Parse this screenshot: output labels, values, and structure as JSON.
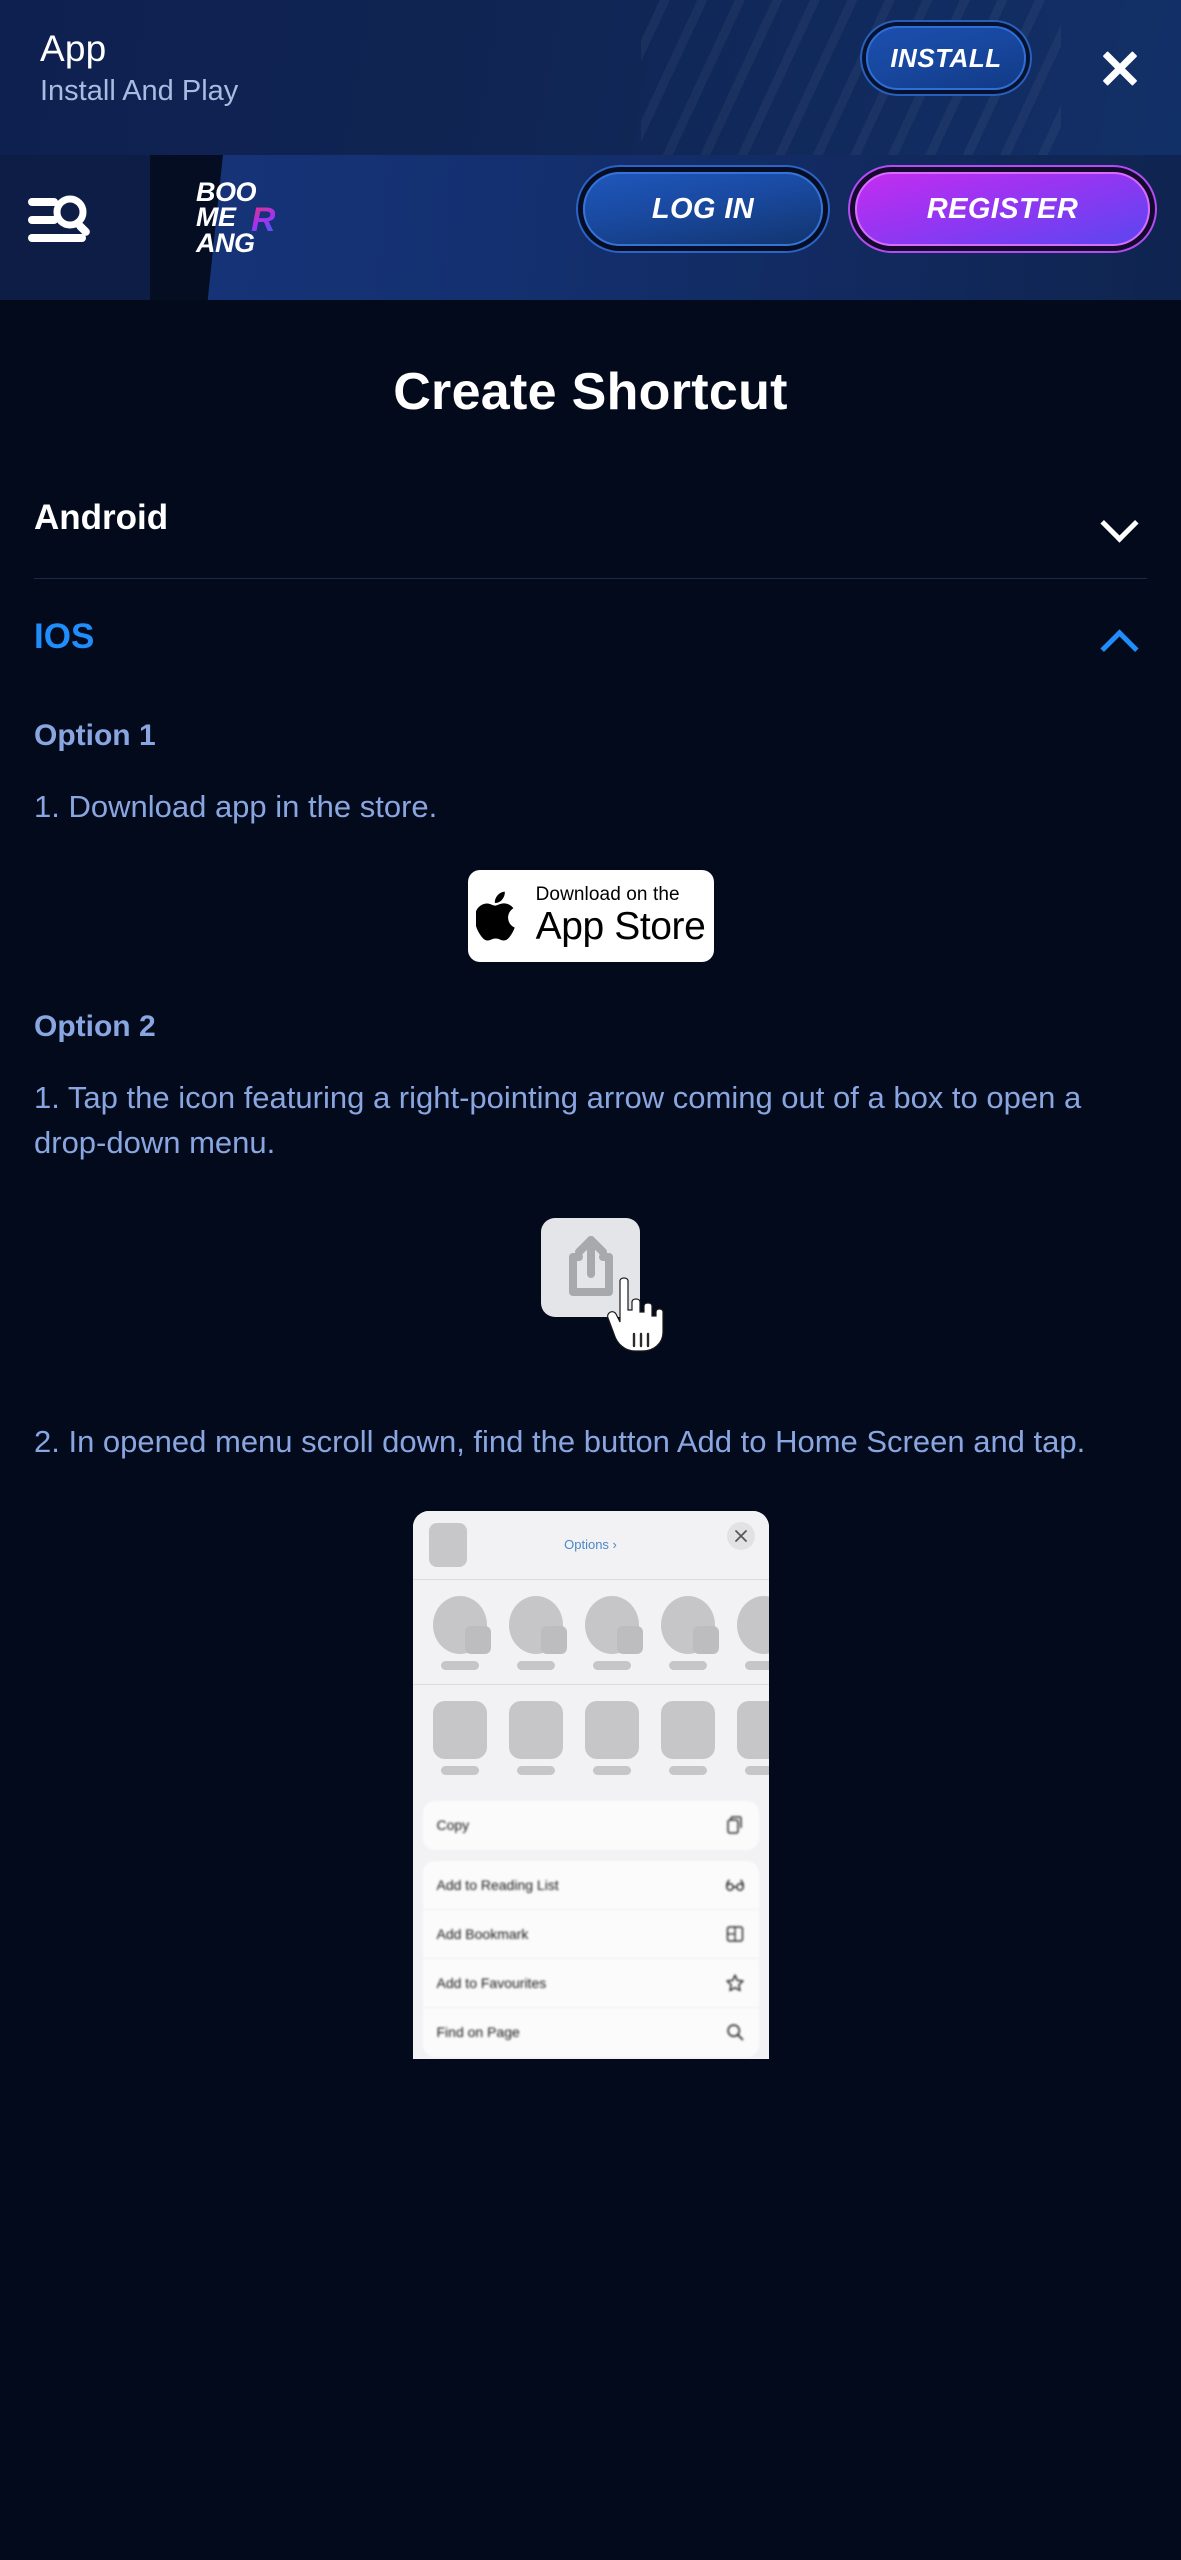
{
  "app_banner": {
    "title": "App",
    "subtitle": "Install And Play",
    "install_label": "INSTALL",
    "close_icon": "close-icon"
  },
  "navbar": {
    "menu_search_icon": "menu-search-icon",
    "logo": {
      "line1": "BOO",
      "line2": "ME",
      "accent": "R",
      "line3": "ANG"
    },
    "login_label": "LOG IN",
    "register_label": "REGISTER"
  },
  "page": {
    "title": "Create Shortcut"
  },
  "accordion": {
    "android": {
      "label": "Android",
      "state": "collapsed",
      "chevron": "chevron-down-icon"
    },
    "ios": {
      "label": "IOS",
      "state": "expanded",
      "chevron": "chevron-up-icon"
    }
  },
  "ios_content": {
    "option1": {
      "title": "Option 1",
      "step1": "1. Download app in the store.",
      "appstore": {
        "small": "Download on the",
        "big": "App Store",
        "icon": "apple-logo-icon"
      }
    },
    "option2": {
      "title": "Option 2",
      "step1": "1. Tap the icon featuring a right-pointing arrow coming out of a box to open a drop-down menu.",
      "share_icon": "share-icon",
      "hand_icon": "hand-pointer-icon",
      "step2": "2. In opened menu scroll down, find the button Add to Home Screen and tap."
    }
  },
  "share_sheet": {
    "options_label": "Options ›",
    "close_icon": "close-icon",
    "contacts": [
      {
        "name_placeholder": ""
      },
      {
        "name_placeholder": ""
      },
      {
        "name_placeholder": ""
      },
      {
        "name_placeholder": ""
      },
      {
        "name_placeholder": ""
      }
    ],
    "apps": [
      {
        "name_placeholder": ""
      },
      {
        "name_placeholder": ""
      },
      {
        "name_placeholder": ""
      },
      {
        "name_placeholder": ""
      },
      {
        "name_placeholder": ""
      }
    ],
    "menu_group_1": [
      {
        "label": "Copy",
        "icon": "copy-icon"
      }
    ],
    "menu_group_2": [
      {
        "label": "Add to Reading List",
        "icon": "glasses-icon"
      },
      {
        "label": "Add Bookmark",
        "icon": "book-icon"
      },
      {
        "label": "Add to Favourites",
        "icon": "star-icon"
      },
      {
        "label": "Find on Page",
        "icon": "magnifier-icon"
      }
    ]
  },
  "colors": {
    "page_background": "#020a1c",
    "banner_background": "#102553",
    "nav_background": "#16347a",
    "accent_blue": "#1f8efc",
    "body_text": "#8aa6e0",
    "register_gradient_start": "#c42df0",
    "register_gradient_end": "#5a46f0"
  }
}
